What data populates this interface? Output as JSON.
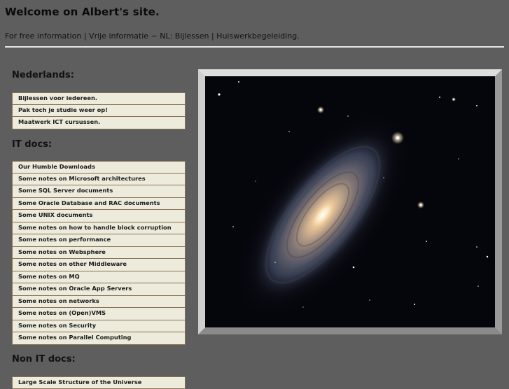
{
  "header": {
    "title": "Welcome on Albert's site.",
    "subtitle": "For free information | Vrije informatie ~ NL: Bijlessen | Huiswerkbegeleiding."
  },
  "sections": {
    "nederlands": {
      "heading": "Nederlands:",
      "items": [
        "Bijlessen voor iedereen.",
        "Pak toch je studie weer op!",
        "Maatwerk ICT cursussen."
      ]
    },
    "it_docs": {
      "heading": "IT docs:",
      "items": [
        "Our Humble Downloads",
        "Some notes on Microsoft architectures",
        "Some SQL Server documents",
        "Some Oracle Database and RAC documents",
        "Some UNIX documents",
        "Some notes on how to handle block corruption",
        "Some notes on performance",
        "Some notes on Websphere",
        "Some notes on other Middleware",
        "Some notes on MQ",
        "Some notes on Oracle App Servers",
        "Some notes on networks",
        "Some notes on (Open)VMS",
        "Some notes on Security",
        "Some notes on Parallel Computing"
      ]
    },
    "non_it_docs": {
      "heading": "Non IT docs:",
      "items": [
        "Large Scale Structure of the Universe"
      ]
    }
  },
  "colors": {
    "page_background": "#5e5e5e",
    "menu_item_background": "#ecebdc",
    "menu_item_border": "#8c7155",
    "header_rule": "#e6e6e6"
  }
}
